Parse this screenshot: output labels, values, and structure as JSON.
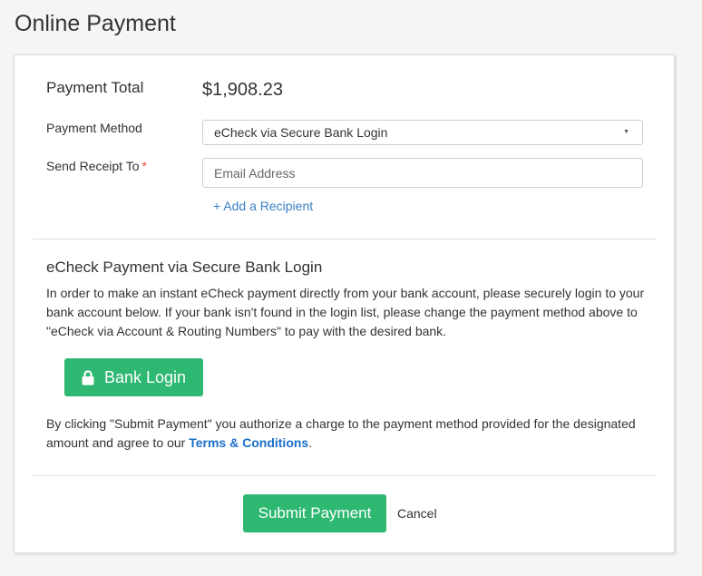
{
  "page": {
    "title": "Online Payment"
  },
  "payment": {
    "total_label": "Payment Total",
    "total_value": "$1,908.23",
    "method_label": "Payment Method",
    "method_selected": "eCheck via Secure Bank Login",
    "receipt_label": "Send Receipt To",
    "required_marker": "*",
    "email_placeholder": "Email Address",
    "email_value": "",
    "add_recipient": "+ Add a Recipient"
  },
  "echeck": {
    "title": "eCheck Payment via Secure Bank Login",
    "description": "In order to make an instant eCheck payment directly from your bank account, please securely login to your bank account below. If your bank isn't found in the login list, please change the payment method above to \"eCheck via Account & Routing Numbers\" to pay with the desired bank.",
    "bank_login_label": "Bank Login",
    "bank_login_icon": "lock-icon"
  },
  "consent": {
    "text_before": "By clicking \"Submit Payment\" you authorize a charge to the payment method provided for the designated amount and agree to our ",
    "terms_link": "Terms & Conditions",
    "text_after": "."
  },
  "actions": {
    "submit_label": "Submit Payment",
    "cancel_label": "Cancel"
  },
  "colors": {
    "accent_green": "#2eb872",
    "link_blue": "#3a7fc4",
    "terms_blue": "#1a6fc9",
    "required_red": "#e74c3c"
  }
}
